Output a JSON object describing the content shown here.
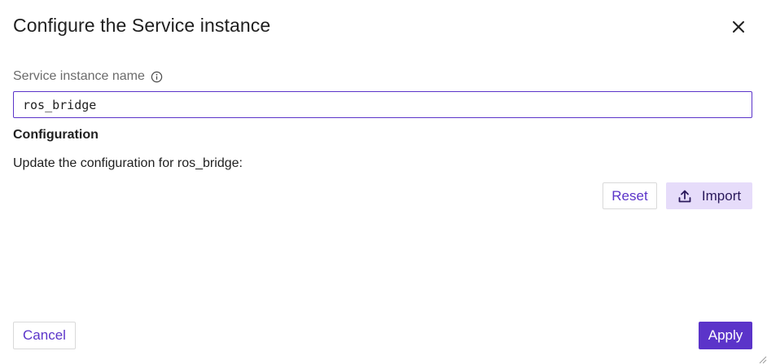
{
  "dialog": {
    "title": "Configure the Service instance",
    "close_icon": "close-icon"
  },
  "name_field": {
    "label": "Service instance name",
    "info_icon": "info-icon",
    "value": "ros_bridge"
  },
  "configuration": {
    "heading": "Configuration",
    "description": "Update the configuration for ros_bridge:",
    "reset_label": "Reset",
    "import_label": "Import",
    "import_icon": "upload-icon"
  },
  "footer": {
    "cancel_label": "Cancel",
    "apply_label": "Apply"
  },
  "colors": {
    "accent": "#5b34c9",
    "import_bg": "#e6dcfa"
  }
}
